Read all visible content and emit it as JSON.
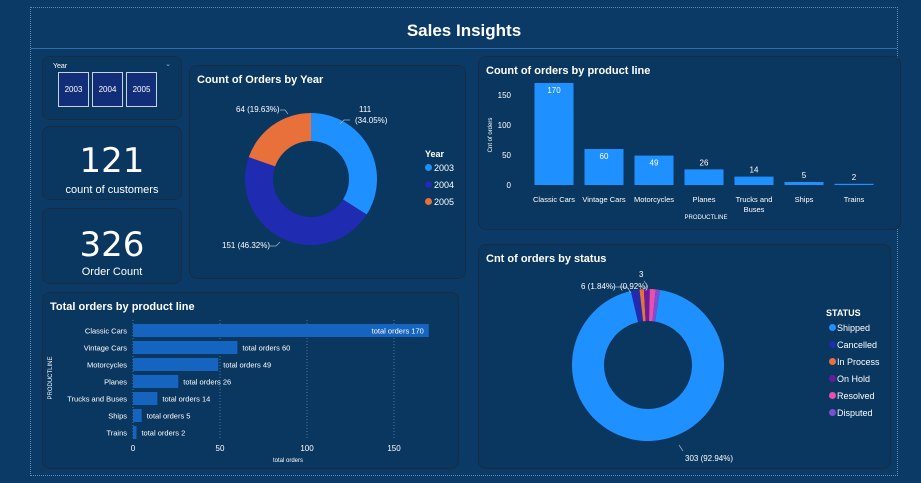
{
  "page": {
    "title": "Sales Insights"
  },
  "slicer": {
    "label": "Year",
    "options": [
      "2003",
      "2004",
      "2005"
    ]
  },
  "kpis": {
    "customers": {
      "value": "121",
      "label": "count of customers"
    },
    "orders": {
      "value": "326",
      "label": "Order Count"
    }
  },
  "colors": {
    "background": "#0b3a66",
    "blue": "#1e90ff",
    "navy": "#1f2bb0",
    "orange": "#e8703a",
    "purple": "#6a1b9a",
    "pink": "#e84fb0",
    "violet": "#7a4fd0",
    "bar_blue": "#1565c0"
  },
  "chart_data": [
    {
      "type": "pie",
      "title": "Count of Orders by Year",
      "legend_title": "Year",
      "legend_position": "right",
      "labels": [
        "2003",
        "2004",
        "2005"
      ],
      "values": [
        111,
        151,
        64
      ],
      "data_labels": [
        "111\n(34.05%)",
        "151 (46.32%)",
        "64 (19.63%)"
      ]
    },
    {
      "type": "bar",
      "title": "Count of orders by product line",
      "xlabel": "PRODUCTLINE",
      "ylabel": "Cnt of orders",
      "categories": [
        "Classic Cars",
        "Vintage Cars",
        "Motorcycles",
        "Planes",
        "Trucks and Buses",
        "Ships",
        "Trains"
      ],
      "values": [
        170,
        60,
        49,
        26,
        14,
        5,
        2
      ],
      "yticks": [
        "0",
        "50",
        "100",
        "150"
      ],
      "ylim": [
        0,
        180
      ]
    },
    {
      "type": "bar",
      "orientation": "horizontal",
      "title": "Total orders by product line",
      "xlabel": "total orders",
      "ylabel": "PRODUCTLINE",
      "categories": [
        "Classic Cars",
        "Vintage Cars",
        "Motorcycles",
        "Planes",
        "Trucks and Buses",
        "Ships",
        "Trains"
      ],
      "values": [
        170,
        60,
        49,
        26,
        14,
        5,
        2
      ],
      "data_label_prefix": "total orders",
      "xticks": [
        "0",
        "50",
        "100",
        "150"
      ],
      "xlim": [
        0,
        175
      ]
    },
    {
      "type": "pie",
      "title": "Cnt of orders by status",
      "legend_title": "STATUS",
      "legend_position": "right",
      "labels": [
        "Shipped",
        "Cancelled",
        "In Process",
        "On Hold",
        "Resolved",
        "Disputed"
      ],
      "values": [
        303,
        6,
        3,
        4,
        4,
        3
      ],
      "data_labels": [
        "303 (92.94%)",
        "6 (1.84%)",
        "3\n(0.92%)"
      ]
    }
  ]
}
